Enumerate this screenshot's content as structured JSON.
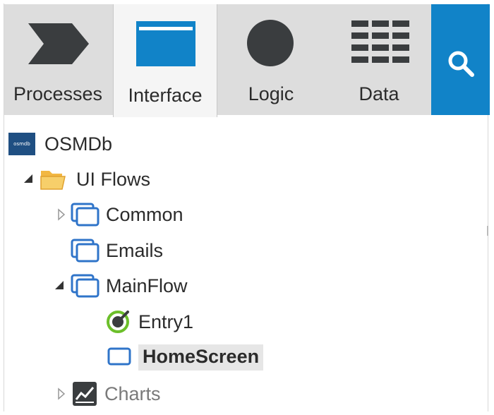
{
  "tabs": {
    "processes": "Processes",
    "interface": "Interface",
    "logic": "Logic",
    "data": "Data"
  },
  "tree": {
    "root": "OSMDb",
    "root_badge": "osmdb",
    "ui_flows": "UI Flows",
    "common": "Common",
    "emails": "Emails",
    "mainflow": "MainFlow",
    "entry1": "Entry1",
    "homescreen": "HomeScreen",
    "charts": "Charts"
  },
  "colors": {
    "accent": "#1183c8",
    "tab_bg": "#dddddd",
    "active_tab_bg": "#f5f5f5",
    "icon_dark": "#3a3d3f",
    "folder": "#f2b742",
    "entry_green": "#6cbf2a"
  }
}
